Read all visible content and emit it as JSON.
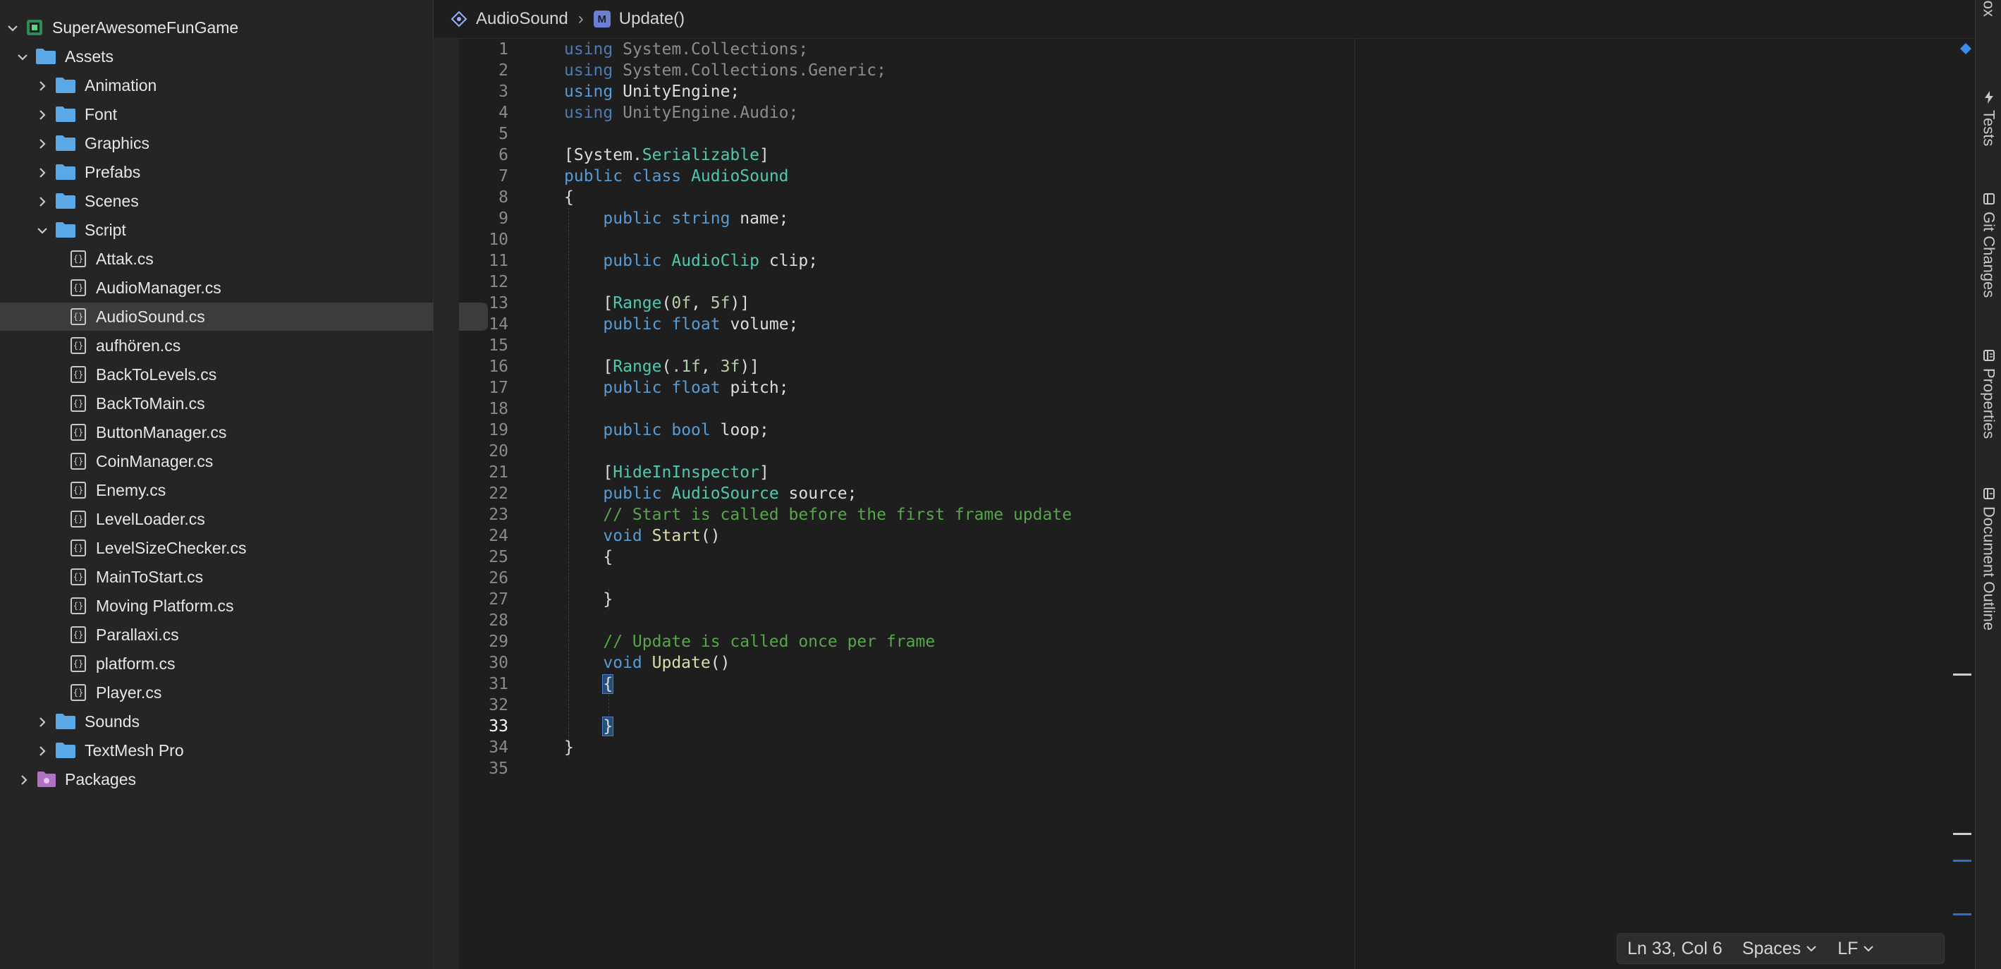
{
  "solution": {
    "name": "SuperAwesomeFunGame",
    "folders": {
      "assets": "Assets",
      "animation": "Animation",
      "font": "Font",
      "graphics": "Graphics",
      "prefabs": "Prefabs",
      "scenes": "Scenes",
      "script": "Script",
      "sounds": "Sounds",
      "textmesh": "TextMesh Pro",
      "packages": "Packages"
    },
    "files": [
      "Attak.cs",
      "AudioManager.cs",
      "AudioSound.cs",
      "aufhören.cs",
      "BackToLevels.cs",
      "BackToMain.cs",
      "ButtonManager.cs",
      "CoinManager.cs",
      "Enemy.cs",
      "LevelLoader.cs",
      "LevelSizeChecker.cs",
      "MainToStart.cs",
      "Moving Platform.cs",
      "Parallaxi.cs",
      "platform.cs",
      "Player.cs"
    ],
    "selected_file": "AudioSound.cs",
    "file_icon_glyph": "{}"
  },
  "breadcrumb": {
    "class_name": "AudioSound",
    "separator": "›",
    "method_name": "Update()",
    "method_badge": "M"
  },
  "code": {
    "line_numbers": [
      "1",
      "2",
      "3",
      "4",
      "5",
      "6",
      "7",
      "8",
      "9",
      "10",
      "11",
      "12",
      "13",
      "14",
      "15",
      "16",
      "17",
      "18",
      "19",
      "20",
      "21",
      "22",
      "23",
      "24",
      "25",
      "26",
      "27",
      "28",
      "29",
      "30",
      "31",
      "32",
      "33",
      "34",
      "35"
    ],
    "current_line": "33",
    "t": {
      "using": "using",
      "sys_col": "System.Collections;",
      "sys_col_gen": "System.Collections.Generic;",
      "unity_engine": "UnityEngine;",
      "unity_audio": "UnityEngine.Audio;",
      "lbr": "[",
      "rbr": "]",
      "system_dot": "System.",
      "serializable": "Serializable",
      "public": "public",
      "class": "class",
      "audio_sound": "AudioSound",
      "open_brace": "{",
      "close_brace": "}",
      "string": "string",
      "name_semi": "name;",
      "audio_clip": "AudioClip",
      "clip_semi": "clip;",
      "range": "Range",
      "lparen": "(",
      "rparen_rbr": ")]",
      "comma_sp": ", ",
      "zero_f": "0f",
      "five_f": "5f",
      "pt1_f": ".1f",
      "three_f": "3f",
      "float": "float",
      "volume_semi": "volume;",
      "pitch_semi": "pitch;",
      "bool": "bool",
      "loop_semi": "loop;",
      "hide_in_inspector": "HideInInspector",
      "audio_source": "AudioSource",
      "source_semi": "source;",
      "comment_start": "// Start is called before the first frame update",
      "void": "void",
      "start": "Start",
      "parens": "()",
      "comment_update": "// Update is called once per frame",
      "update": "Update"
    }
  },
  "side_tabs": {
    "toolbox": "Toolbox",
    "tests": "Tests",
    "git_changes": "Git Changes",
    "properties": "Properties",
    "document_outline": "Document Outline"
  },
  "status_bar": {
    "position": "Ln 33, Col 6",
    "indentation": "Spaces",
    "line_endings": "LF"
  },
  "colors": {
    "background": "#1e1e1e",
    "sidebar": "#252526",
    "keyword": "#569cd6",
    "type": "#4ec9b0",
    "comment": "#57a64a",
    "number": "#b5cea8",
    "folder": "#5aa9e6",
    "selection": "#264f78"
  }
}
